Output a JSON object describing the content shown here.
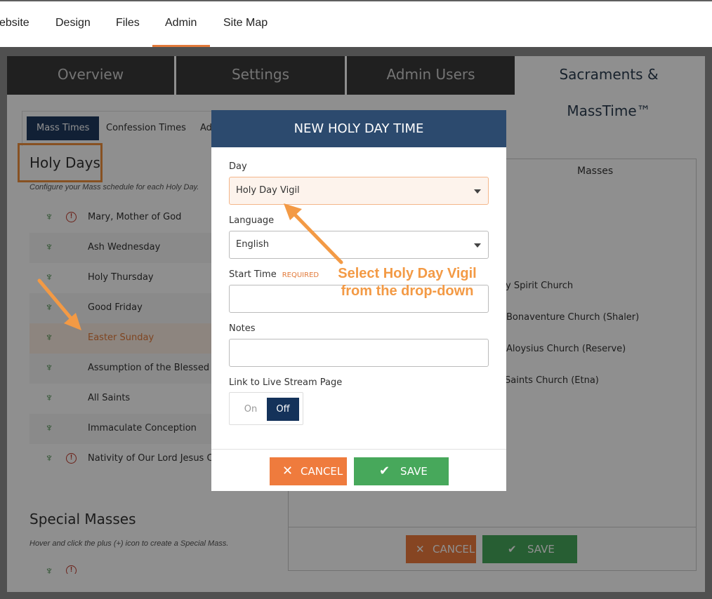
{
  "topnav": {
    "items": [
      "ebsite",
      "Design",
      "Files",
      "Admin",
      "Site Map"
    ],
    "active": "Admin"
  },
  "tabs": [
    "Overview",
    "Settings",
    "Admin Users",
    "Sacraments & MassTime™"
  ],
  "subtabs": [
    "Mass Times",
    "Confession Times",
    "Ad"
  ],
  "holy_days": {
    "title": "Holy Days",
    "subtitle": "Configure your Mass schedule for each Holy Day.",
    "items": [
      {
        "label": "Mary, Mother of God",
        "warning": true
      },
      {
        "label": "Ash Wednesday",
        "warning": false
      },
      {
        "label": "Holy Thursday",
        "warning": false
      },
      {
        "label": "Good Friday",
        "warning": false
      },
      {
        "label": "Easter Sunday",
        "warning": false
      },
      {
        "label": "Assumption of the Blessed Virg",
        "warning": false
      },
      {
        "label": "All Saints",
        "warning": false
      },
      {
        "label": "Immaculate Conception",
        "warning": false
      },
      {
        "label": "Nativity of Our Lord Jesus Chri",
        "warning": true
      }
    ]
  },
  "special_masses": {
    "title": "Special Masses",
    "subtitle": "Hover and click the plus (+) icon to create a Special Mass."
  },
  "masses": {
    "header": "Masses",
    "churches": [
      "y Spirit Church",
      "Bonaventure Church (Shaler)",
      "Aloysius Church (Reserve)",
      "Saints Church (Etna)"
    ]
  },
  "page_buttons": {
    "cancel": "CANCEL",
    "save": "SAVE"
  },
  "modal": {
    "title": "NEW HOLY DAY TIME",
    "day_label": "Day",
    "day_value": "Holy Day Vigil",
    "language_label": "Language",
    "language_value": "English",
    "start_time_label": "Start Time",
    "start_time_required": "REQUIRED",
    "notes_label": "Notes",
    "live_stream_label": "Link to Live Stream Page",
    "toggle_on": "On",
    "toggle_off": "Off",
    "cancel": "CANCEL",
    "save": "SAVE"
  },
  "annotation": {
    "line1": "Select Holy Day Vigil",
    "line2": "from the drop-down"
  },
  "colors": {
    "accent": "#f39a45",
    "navy": "#2c4a6e",
    "cancel": "#ef7b3d",
    "save": "#47a85b"
  }
}
